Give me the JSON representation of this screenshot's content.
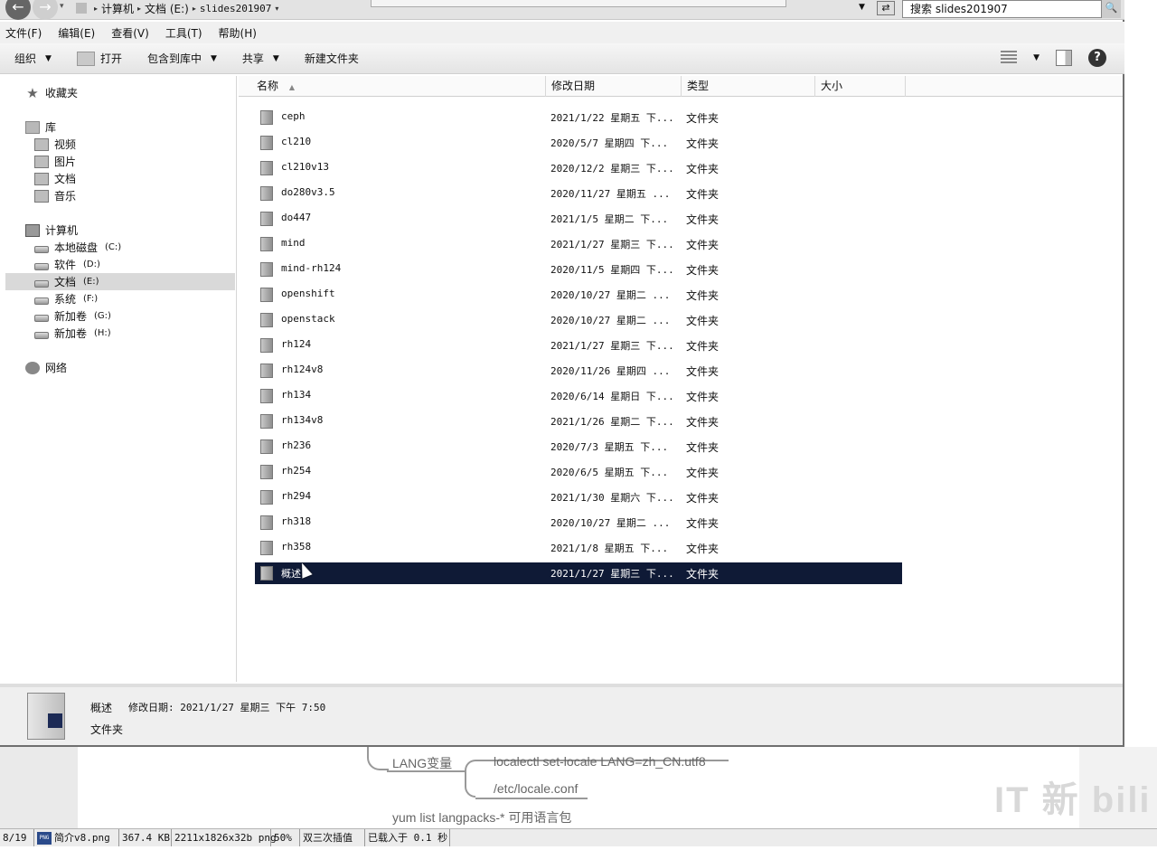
{
  "address": {
    "crumbs": [
      "计算机",
      "文档 (E:)",
      "slides201907"
    ]
  },
  "search": {
    "placeholder": "搜索 slides201907"
  },
  "menu": [
    "文件(F)",
    "编辑(E)",
    "查看(V)",
    "工具(T)",
    "帮助(H)"
  ],
  "toolbar": {
    "organize": "组织",
    "open": "打开",
    "include": "包含到库中",
    "share": "共享",
    "new_folder": "新建文件夹"
  },
  "nav": {
    "favorites": "收藏夹",
    "libraries": "库",
    "lib_items": [
      "视频",
      "图片",
      "文档",
      "音乐"
    ],
    "computer": "计算机",
    "drives": [
      {
        "label": "本地磁盘",
        "letter": "(C:)"
      },
      {
        "label": "软件",
        "letter": "(D:)"
      },
      {
        "label": "文档",
        "letter": "(E:)"
      },
      {
        "label": "系统",
        "letter": "(F:)"
      },
      {
        "label": "新加卷",
        "letter": "(G:)"
      },
      {
        "label": "新加卷",
        "letter": "(H:)"
      }
    ],
    "network": "网络"
  },
  "columns": {
    "name": "名称",
    "date": "修改日期",
    "type": "类型",
    "size": "大小"
  },
  "files": [
    {
      "name": "ceph",
      "date": "2021/1/22 星期五 下...",
      "type": "文件夹"
    },
    {
      "name": "cl210",
      "date": "2020/5/7 星期四 下...",
      "type": "文件夹"
    },
    {
      "name": "cl210v13",
      "date": "2020/12/2 星期三 下...",
      "type": "文件夹"
    },
    {
      "name": "do280v3.5",
      "date": "2020/11/27 星期五 ...",
      "type": "文件夹"
    },
    {
      "name": "do447",
      "date": "2021/1/5 星期二 下...",
      "type": "文件夹"
    },
    {
      "name": "mind",
      "date": "2021/1/27 星期三 下...",
      "type": "文件夹"
    },
    {
      "name": "mind-rh124",
      "date": "2020/11/5 星期四 下...",
      "type": "文件夹"
    },
    {
      "name": "openshift",
      "date": "2020/10/27 星期二 ...",
      "type": "文件夹"
    },
    {
      "name": "openstack",
      "date": "2020/10/27 星期二 ...",
      "type": "文件夹"
    },
    {
      "name": "rh124",
      "date": "2021/1/27 星期三 下...",
      "type": "文件夹"
    },
    {
      "name": "rh124v8",
      "date": "2020/11/26 星期四 ...",
      "type": "文件夹"
    },
    {
      "name": "rh134",
      "date": "2020/6/14 星期日 下...",
      "type": "文件夹"
    },
    {
      "name": "rh134v8",
      "date": "2021/1/26 星期二 下...",
      "type": "文件夹"
    },
    {
      "name": "rh236",
      "date": "2020/7/3 星期五 下...",
      "type": "文件夹"
    },
    {
      "name": "rh254",
      "date": "2020/6/5 星期五 下...",
      "type": "文件夹"
    },
    {
      "name": "rh294",
      "date": "2021/1/30 星期六 下...",
      "type": "文件夹"
    },
    {
      "name": "rh318",
      "date": "2020/10/27 星期二 ...",
      "type": "文件夹"
    },
    {
      "name": "rh358",
      "date": "2021/1/8 星期五 下...",
      "type": "文件夹"
    },
    {
      "name": "概述",
      "date": "2021/1/27 星期三 下...",
      "type": "文件夹",
      "selected": true
    }
  ],
  "details": {
    "name": "概述",
    "date": "修改日期: 2021/1/27 星期三 下午 7:50",
    "type": "文件夹"
  },
  "mindmap": {
    "node": "LANG变量",
    "cmd": "localectl  set-locale LANG=zh_CN.utf8",
    "file": "/etc/locale.conf",
    "yum": "yum list langpacks-* 可用语言包"
  },
  "watermark": "IT 新 bili",
  "status": {
    "index": "8/19",
    "filename": "简介v8.png",
    "size": "367.4 KB",
    "dims": "2211x1826x32b png",
    "zoom": "50%",
    "interp": "双三次插值",
    "load": "已载入于 0.1 秒"
  }
}
